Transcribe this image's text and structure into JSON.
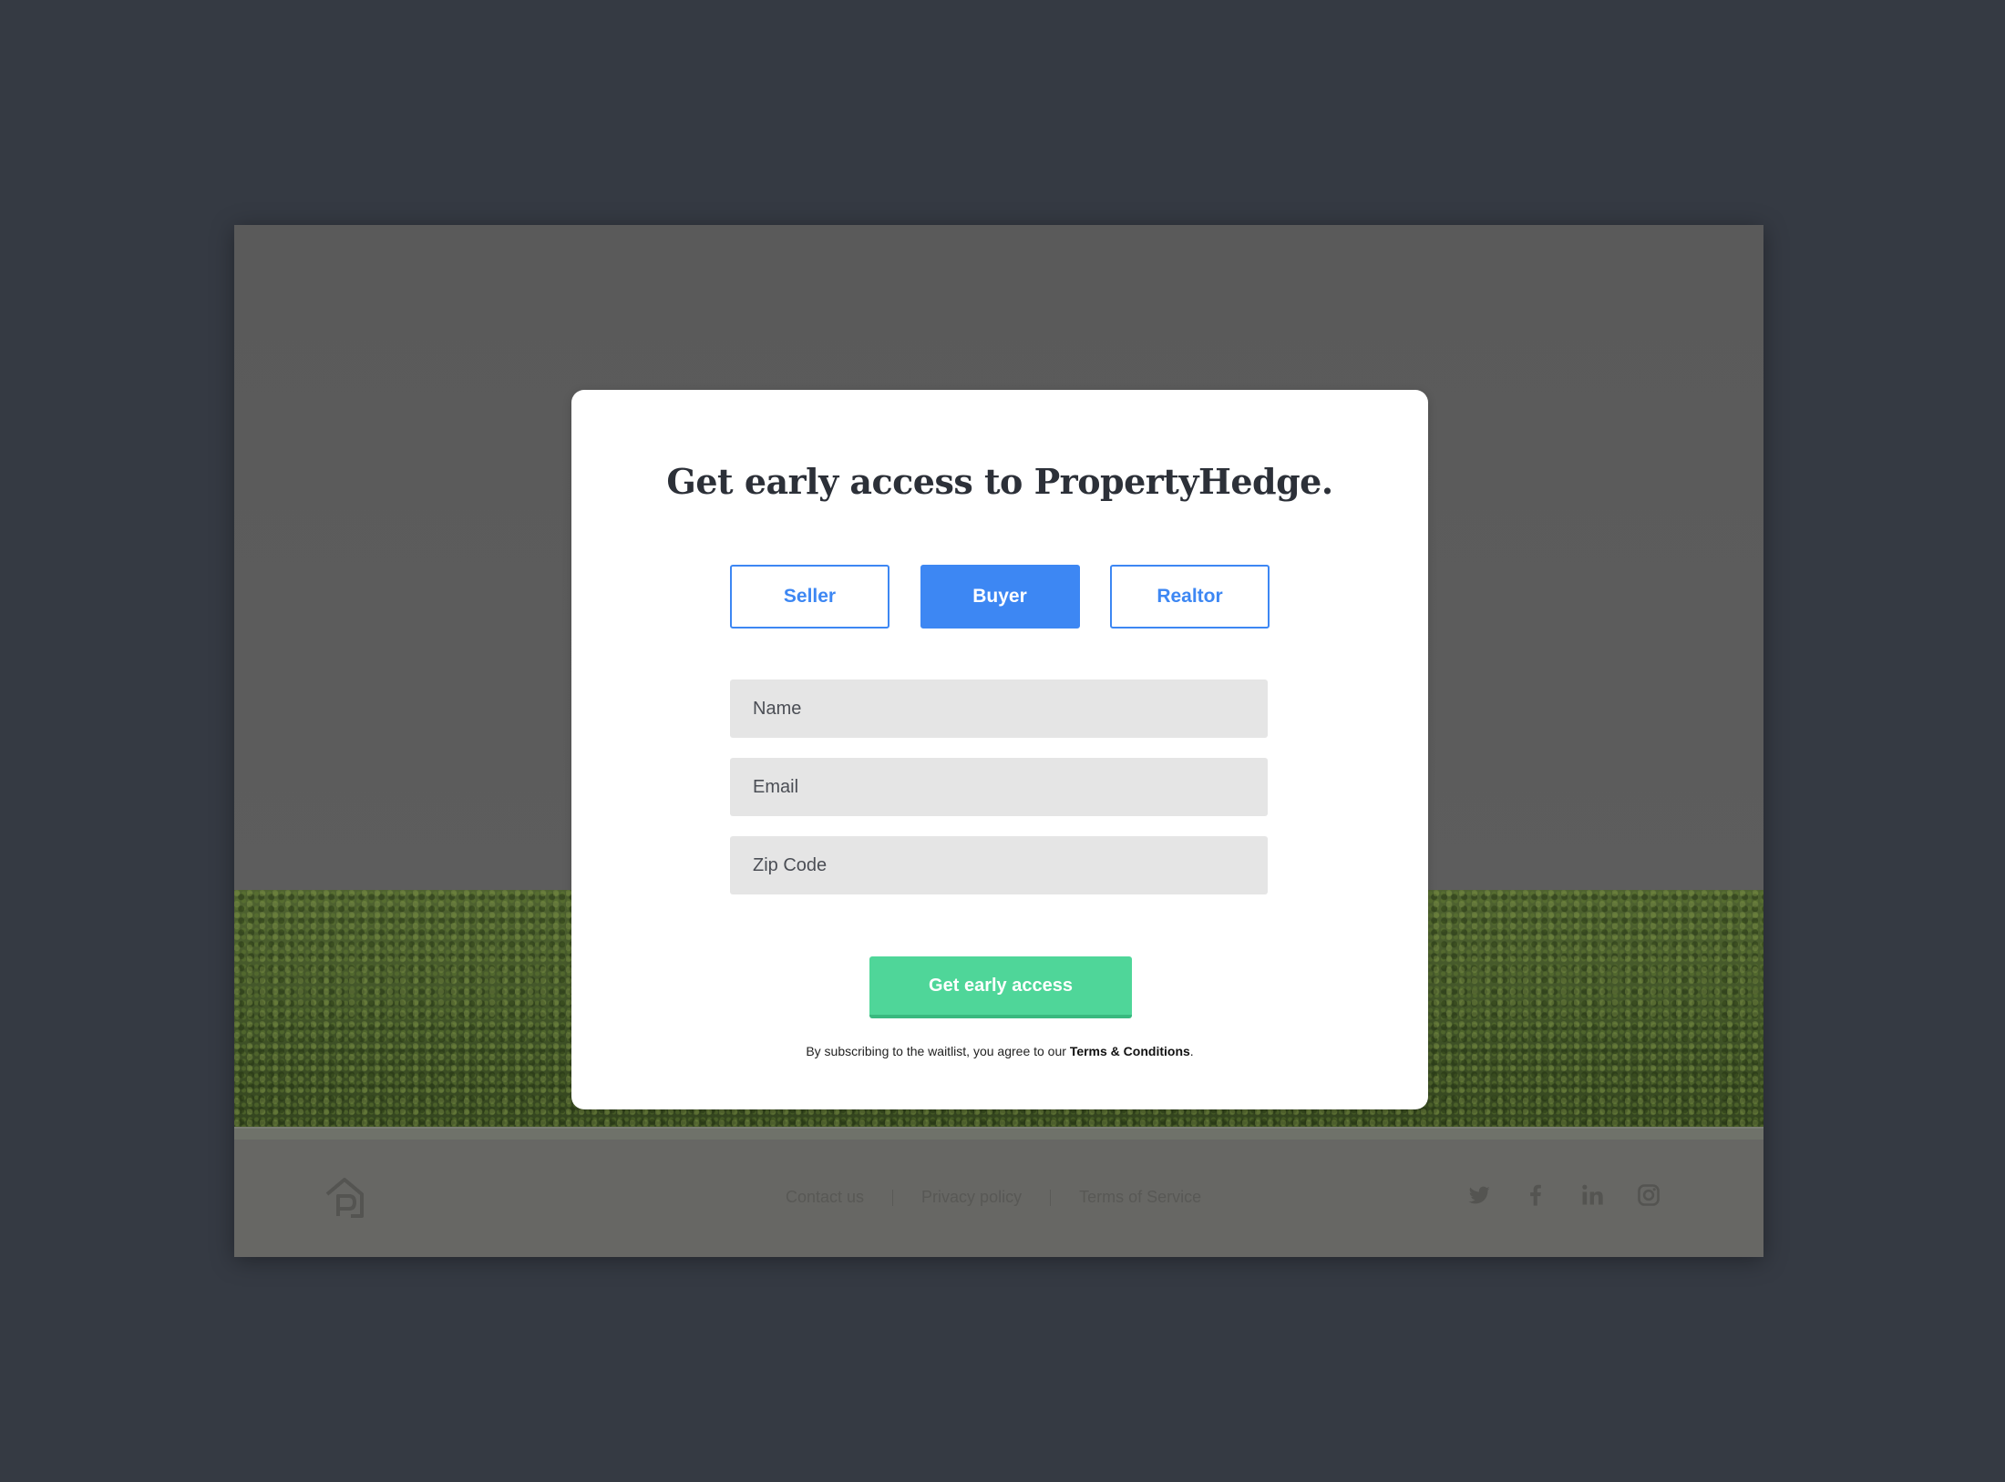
{
  "modal": {
    "title": "Get early access to PropertyHedge.",
    "roles": [
      {
        "label": "Seller",
        "active": false
      },
      {
        "label": "Buyer",
        "active": true
      },
      {
        "label": "Realtor",
        "active": false
      }
    ],
    "fields": {
      "name_placeholder": "Name",
      "email_placeholder": "Email",
      "zip_placeholder": "Zip Code"
    },
    "submit_label": "Get early access",
    "disclaimer_prefix": "By subscribing to the waitlist, you agree to our ",
    "disclaimer_link": "Terms & Conditions",
    "disclaimer_suffix": "."
  },
  "footer": {
    "links": [
      "Contact us",
      "Privacy policy",
      "Terms of Service"
    ],
    "social_icons": [
      "twitter-icon",
      "facebook-icon",
      "linkedin-icon",
      "instagram-icon"
    ]
  },
  "colors": {
    "accent_blue": "#3d87f3",
    "accent_green": "#4fd699",
    "page_bg": "#353a43",
    "input_bg": "#e5e5e5"
  }
}
